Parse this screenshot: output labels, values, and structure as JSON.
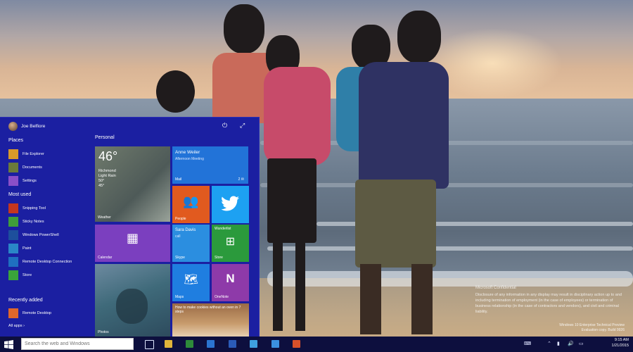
{
  "user": {
    "name": "Joe Belfiore"
  },
  "start_menu": {
    "places_header": "Places",
    "places": [
      {
        "label": "File Explorer",
        "icon": "folder-icon",
        "color": "#d99a2a"
      },
      {
        "label": "Documents",
        "icon": "documents-icon",
        "color": "#6b7a3a"
      },
      {
        "label": "Settings",
        "icon": "gear-icon",
        "color": "#8a4fc8"
      }
    ],
    "most_used_header": "Most used",
    "most_used": [
      {
        "label": "Snipping Tool",
        "icon": "scissors-icon",
        "color": "#c4361f"
      },
      {
        "label": "Sticky Notes",
        "icon": "sticky-note-icon",
        "color": "#3f9d3a"
      },
      {
        "label": "Windows PowerShell",
        "icon": "terminal-icon",
        "color": "#1d4f9c"
      },
      {
        "label": "Paint",
        "icon": "paint-icon",
        "color": "#2a86c7"
      },
      {
        "label": "Remote Desktop Connection",
        "icon": "remote-desktop-icon",
        "color": "#1f6fc0"
      },
      {
        "label": "Store",
        "icon": "shopping-bag-icon",
        "color": "#3aa43a"
      }
    ],
    "recently_added_header": "Recently added",
    "recently_added": [
      {
        "label": "Remote Desktop",
        "icon": "remote-desktop-icon",
        "color": "#e0672a"
      }
    ],
    "all_apps_label": "All apps ›",
    "personal_header": "Personal"
  },
  "tiles": {
    "weather": {
      "name": "Weather",
      "temp": "46°",
      "city": "Richmond",
      "conditions": "Light Rain",
      "high": "50°",
      "low": "45°"
    },
    "mail": {
      "from": "Anne Weiler",
      "subject": "Afternoon Meeting",
      "name": "Mail",
      "count": "2"
    },
    "people": {
      "name": "People",
      "color": "#e15a1f"
    },
    "twitter": {
      "name": "",
      "color": "#1da1f2"
    },
    "calendar": {
      "name": "Calendar",
      "color": "#7b3fbf"
    },
    "skype": {
      "contact": "Sara Davis",
      "status": "call",
      "name": "Skype",
      "color": "#2b8ee0"
    },
    "store": {
      "top": "Wunderlist",
      "name": "Store",
      "color": "#2b9a3c"
    },
    "photos": {
      "name": "Photos"
    },
    "maps": {
      "name": "Maps",
      "color": "#1f7ee0"
    },
    "onenote": {
      "name": "OneNote",
      "color": "#8e3aa9"
    },
    "news": {
      "caption": "How to make cookies without an oven in 7 steps",
      "name": ""
    }
  },
  "taskbar": {
    "search_placeholder": "Search the web and Windows",
    "apps": [
      {
        "name": "task-view-icon",
        "color": "#dfe6ff"
      },
      {
        "name": "file-explorer-icon",
        "color": "#e0b33a"
      },
      {
        "name": "excel-icon",
        "color": "#2e8b3a"
      },
      {
        "name": "media-player-icon",
        "color": "#2b74d0"
      },
      {
        "name": "word-icon",
        "color": "#2b5bb8"
      },
      {
        "name": "store-icon",
        "color": "#3fa0e0"
      },
      {
        "name": "mail-icon",
        "color": "#3b8fe0"
      },
      {
        "name": "office-icon",
        "color": "#d8502a"
      }
    ],
    "time": "9:15 AM",
    "date": "1/21/2015"
  },
  "watermark": {
    "title": "Microsoft Confidential",
    "body": "Disclosure of any information in any display may result in disciplinary action up to and including termination of employment (in the case of employees) or termination of business relationship (in the case of contractors and vendors), and civil and criminal liability.",
    "build_line1": "Windows 10 Enterprise Technical Preview",
    "build_line2": "Evaluation copy. Build 9926"
  }
}
